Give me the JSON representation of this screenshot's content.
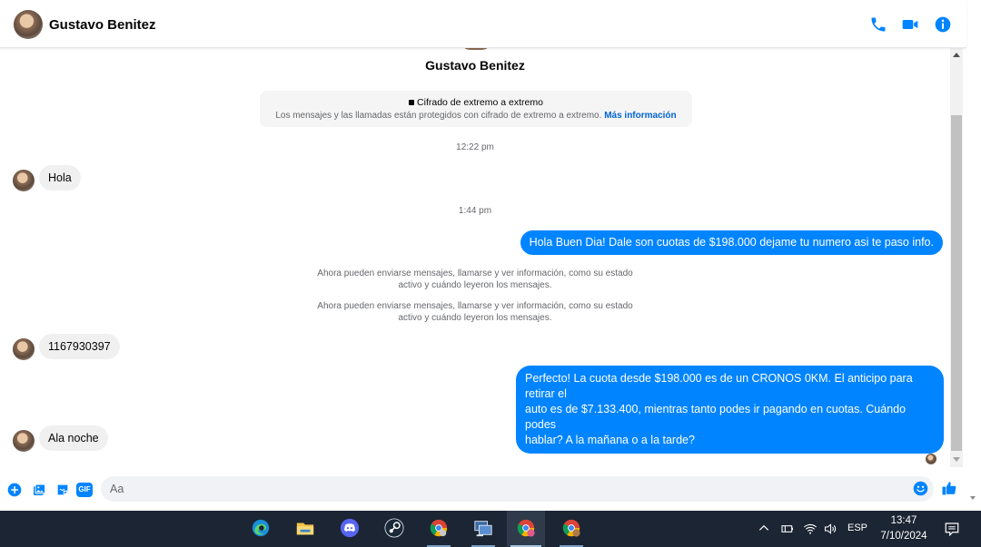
{
  "header": {
    "contact_name": "Gustavo Benitez",
    "icons": [
      "phone-icon",
      "video-camera-icon",
      "info-icon"
    ],
    "accent_color": "#0084ff"
  },
  "profile": {
    "name": "Gustavo Benitez"
  },
  "encryption_notice": {
    "title": "Cifrado de extremo a extremo",
    "text": "Los mensajes y las llamadas están protegidos con cifrado de extremo a extremo.",
    "link": "Más información"
  },
  "messages": {
    "time1": "12:22 pm",
    "in1": "Hola",
    "time2": "1:44 pm",
    "out1": "Hola Buen Dia! Dale son cuotas de $198.000 dejame tu numero asi te paso info.",
    "notice1_line1": "Ahora pueden enviarse mensajes, llamarse y ver información, como su estado",
    "notice1_line2": "activo y cuándo leyeron los mensajes.",
    "notice2_line1": "Ahora pueden enviarse mensajes, llamarse y ver información, como su estado",
    "notice2_line2": "activo y cuándo leyeron los mensajes.",
    "in2": "1167930397",
    "out2_line1": "Perfecto! La cuota desde $198.000 es de un CRONOS 0KM. El anticipo para retirar el",
    "out2_line2": "auto es de $7.133.400, mientras tanto podes ir pagando en cuotas. Cuándo podes",
    "out2_line3": "hablar? A la mañana o a la tarde?",
    "in3": "Ala noche"
  },
  "composer": {
    "placeholder": "Aa",
    "icons": [
      "plus-circle-icon",
      "photo-icon",
      "sticker-icon",
      "gif-icon",
      "emoji-icon",
      "thumbs-up-icon"
    ],
    "gif_label": "GIF"
  },
  "taskbar": {
    "apps": [
      "edge-icon",
      "file-explorer-icon",
      "discord-icon",
      "steam-icon",
      "chrome-icon",
      "network-pc-icon",
      "chrome-profile-icon",
      "chrome-profile-icon"
    ],
    "language": "ESP",
    "time": "13:47",
    "date": "7/10/2024"
  }
}
